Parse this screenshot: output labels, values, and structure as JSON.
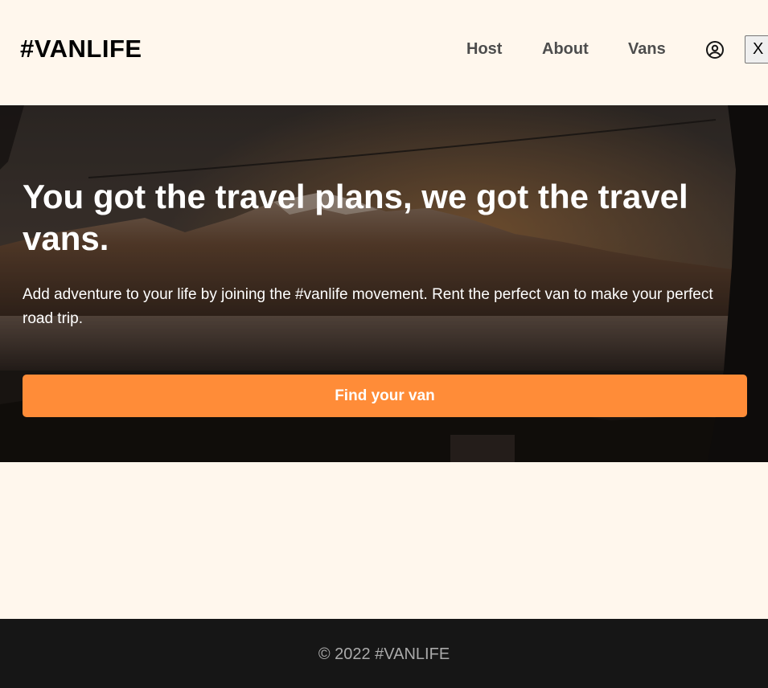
{
  "header": {
    "logo": "#VANLIFE",
    "nav": [
      {
        "label": "Host"
      },
      {
        "label": "About"
      },
      {
        "label": "Vans"
      }
    ],
    "user_icon": "user-circle-icon",
    "close_button": "X"
  },
  "hero": {
    "title": "You got the travel plans, we got the travel vans.",
    "text": "Add adventure to your life by joining the #vanlife movement. Rent the perfect van to make your perfect road trip.",
    "button": "Find your van"
  },
  "footer": {
    "copyright": "© 2022 #VANLIFE"
  },
  "colors": {
    "background": "#FFF7ED",
    "accent": "#FF8C38",
    "footer_bg": "#161616",
    "footer_text": "#AAAAAA",
    "nav_text": "#4D4D4D"
  }
}
